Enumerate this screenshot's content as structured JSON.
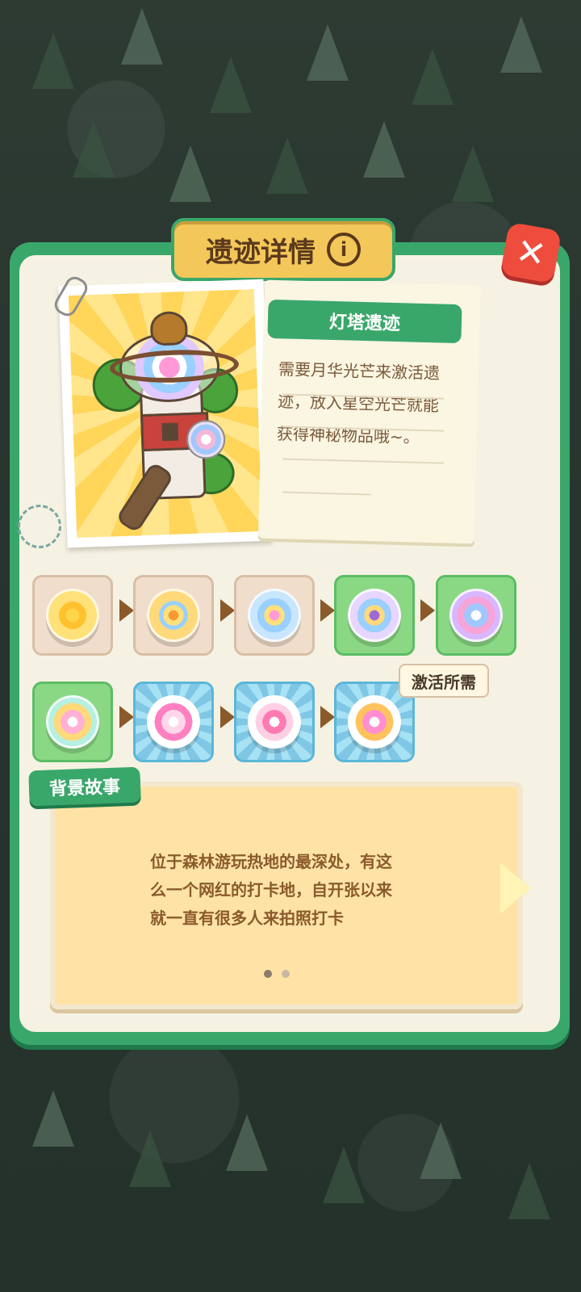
{
  "header": {
    "title": "遗迹详情",
    "info_icon": "info-icon",
    "close_icon": "close-icon"
  },
  "relic": {
    "name": "灯塔遗迹",
    "description_lines": [
      "需要月华光芒来激活遗",
      "迹，放入星空光芒就能",
      "获得神秘物品哦~。"
    ]
  },
  "evolution": {
    "stages_row1": [
      "o1",
      "o2",
      "o3",
      "o4",
      "o5"
    ],
    "stages_row2": [
      "o6",
      "o7",
      "o8",
      "o9"
    ],
    "activation_label": "激活所需"
  },
  "story": {
    "tag": "背景故事",
    "lines": [
      "位于森林游玩热地的最深处，有这",
      "么一个网红的打卡地，自开张以来",
      "就一直有很多人来拍照打卡"
    ],
    "page_dots": 2,
    "active_dot": 0
  },
  "colors": {
    "panel_green": "#3aa76a",
    "title_gold": "#f4c75a",
    "close_red": "#ee4d3d",
    "story_bg": "#ffe3a6"
  }
}
